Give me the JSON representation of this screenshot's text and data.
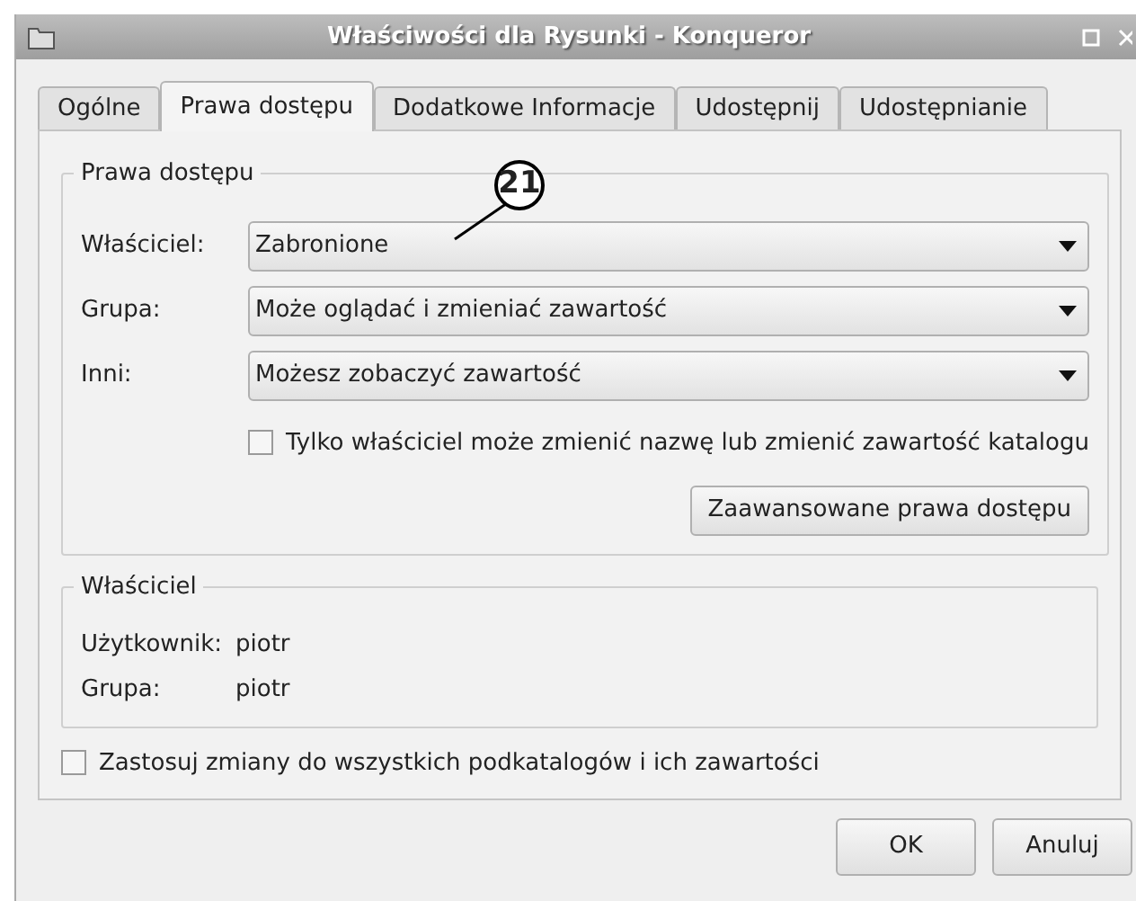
{
  "window": {
    "title": "Właściwości dla Rysunki - Konqueror"
  },
  "tabs": [
    {
      "label": "Ogólne",
      "selected": false
    },
    {
      "label": "Prawa dostępu",
      "selected": true
    },
    {
      "label": "Dodatkowe Informacje",
      "selected": false
    },
    {
      "label": "Udostępnij",
      "selected": false
    },
    {
      "label": "Udostępnianie",
      "selected": false
    }
  ],
  "permissions": {
    "title": "Prawa dostępu",
    "rows": [
      {
        "label": "Właściciel:",
        "value": "Zabronione"
      },
      {
        "label": "Grupa:",
        "value": "Może oglądać i zmieniać zawartość"
      },
      {
        "label": "Inni:",
        "value": "Możesz zobaczyć zawartość"
      }
    ],
    "owner_only": {
      "label": "Tylko właściciel może zmienić nazwę lub zmienić zawartość katalogu",
      "checked": false
    },
    "advanced_button": "Zaawansowane prawa dostępu"
  },
  "owner": {
    "title": "Właściciel",
    "rows": [
      {
        "label": "Użytkownik:",
        "value": "piotr"
      },
      {
        "label": "Grupa:",
        "value": "piotr"
      }
    ]
  },
  "apply_recursive": {
    "label": "Zastosuj zmiany do wszystkich podkatalogów i ich zawartości",
    "checked": false
  },
  "callout": "21",
  "buttons": [
    "OK",
    "Anuluj"
  ]
}
